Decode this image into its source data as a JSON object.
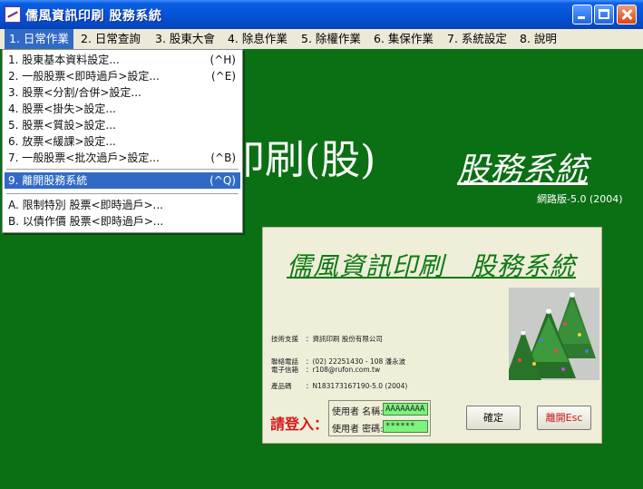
{
  "window": {
    "title": "儒風資訊印刷 股務系統",
    "controls": {
      "minimize_icon": "minimize-icon",
      "maximize_icon": "maximize-icon",
      "close_icon": "close-icon"
    }
  },
  "menubar": {
    "items": [
      {
        "label": "1. 日常作業",
        "active": true
      },
      {
        "label": "2. 日常查詢"
      },
      {
        "label": "3. 股東大會"
      },
      {
        "label": "4. 除息作業"
      },
      {
        "label": "5. 除權作業"
      },
      {
        "label": "6. 集保作業"
      },
      {
        "label": "7. 系統設定"
      },
      {
        "label": "8. 說明"
      }
    ]
  },
  "dropdown": {
    "items": [
      {
        "label": "1. 股東基本資料設定...",
        "shortcut": "(^H)"
      },
      {
        "label": "2. 一般股票<即時過戶>設定...",
        "shortcut": "(^E)"
      },
      {
        "label": "3. 股票<分割/合併>設定...",
        "shortcut": ""
      },
      {
        "label": "4. 股票<掛失>設定...",
        "shortcut": ""
      },
      {
        "label": "5. 股票<質設>設定...",
        "shortcut": ""
      },
      {
        "label": "6. 放票<緩課>設定...",
        "shortcut": ""
      },
      {
        "label": "7. 一般股票<批次過戶>設定...",
        "shortcut": "(^B)"
      },
      {
        "label": "9. 離開股務系統",
        "shortcut": "(^Q)",
        "highlighted": true
      },
      {
        "label": "A. 限制特別 股票<即時過戶>...",
        "shortcut": ""
      },
      {
        "label": "B. 以債作價 股票<即時過戶>...",
        "shortcut": ""
      }
    ]
  },
  "background": {
    "title": "印刷(股)",
    "subtitle": "股務系統",
    "version": "網路版-5.0 (2004)"
  },
  "login": {
    "title": "儒風資訊印刷　股務系統",
    "info": {
      "support_label": "技術支援",
      "support_value": "：資訊印刷 股份有限公司",
      "phone_label": "聯絡電話",
      "phone_value": "：(02) 22251430 - 108 潘永波",
      "email_label": "電子信箱",
      "email_value": "：r108@rufon.com.tw",
      "product_label": "產品碼",
      "product_value": "：N183173167190-5.0 (2004)"
    },
    "prompt": "請登入：",
    "username_label": "使用者 名稱:",
    "username_value": "AAAAAAAA",
    "password_label": "使用者 密碼:",
    "password_value": "******",
    "ok_label": "確定",
    "exit_label": "離開Esc",
    "colors": {
      "field_bg": "#7ef27e",
      "prompt": "#d41a1a",
      "title": "#0b7a12"
    }
  }
}
